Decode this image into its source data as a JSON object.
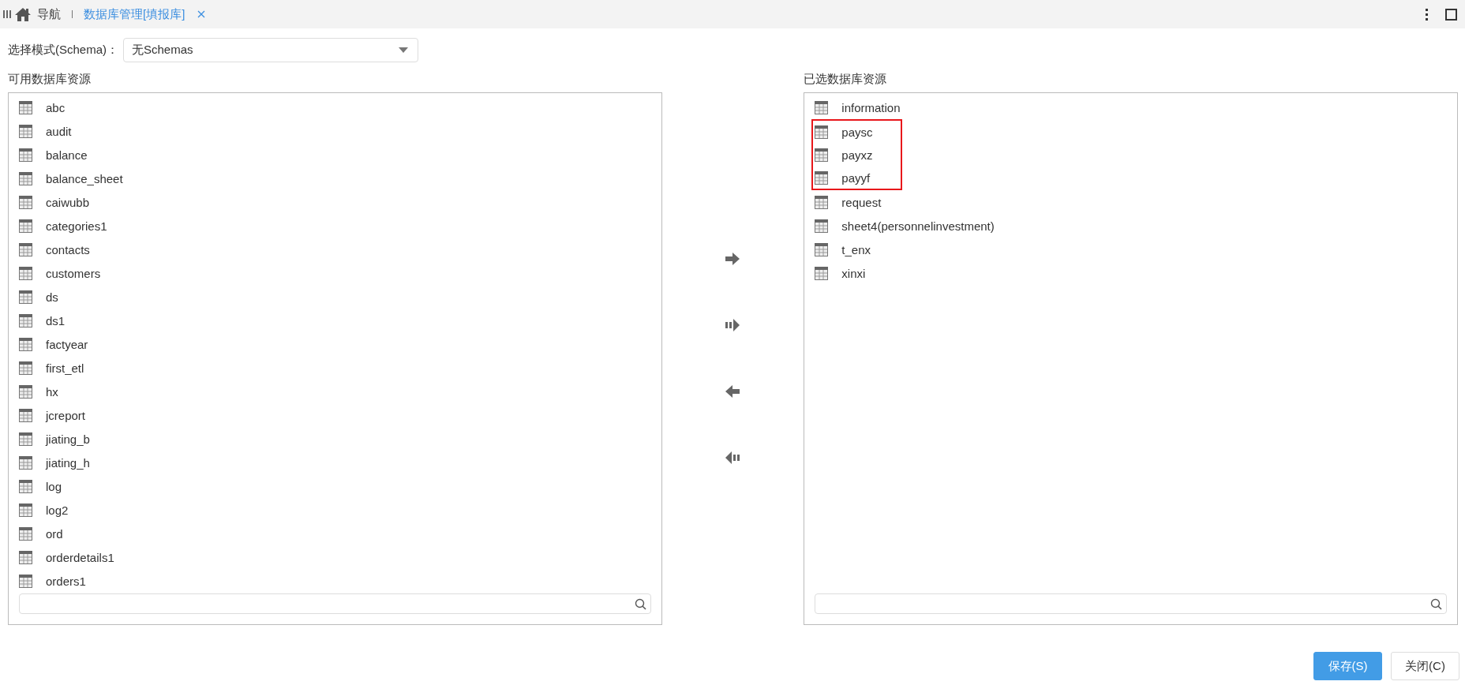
{
  "tabbar": {
    "nav_label": "导航",
    "tabs": [
      {
        "label": "数据库管理[填报库]",
        "selected": true
      }
    ]
  },
  "schema": {
    "label": "选择模式(Schema)：",
    "value": "无Schemas"
  },
  "available": {
    "title": "可用数据库资源",
    "items": [
      {
        "name": "abc"
      },
      {
        "name": "audit"
      },
      {
        "name": "balance"
      },
      {
        "name": "balance_sheet"
      },
      {
        "name": "caiwubb"
      },
      {
        "name": "categories1"
      },
      {
        "name": "contacts"
      },
      {
        "name": "customers"
      },
      {
        "name": "ds"
      },
      {
        "name": "ds1"
      },
      {
        "name": "factyear"
      },
      {
        "name": "first_etl"
      },
      {
        "name": "hx"
      },
      {
        "name": "jcreport"
      },
      {
        "name": "jiating_b"
      },
      {
        "name": "jiating_h"
      },
      {
        "name": "log"
      },
      {
        "name": "log2"
      },
      {
        "name": "ord"
      },
      {
        "name": "orderdetails1"
      },
      {
        "name": "orders1"
      }
    ]
  },
  "transfer_buttons": [
    {
      "kind": "add"
    },
    {
      "kind": "add_all"
    },
    {
      "kind": "remove"
    },
    {
      "kind": "remove_all"
    }
  ],
  "selected_resources": {
    "title": "已选数据库资源",
    "items": [
      {
        "name": "information",
        "highlighted": false
      },
      {
        "name": "paysc",
        "highlighted": true
      },
      {
        "name": "payxz",
        "highlighted": true
      },
      {
        "name": "payyf",
        "highlighted": true
      },
      {
        "name": "request",
        "highlighted": false
      },
      {
        "name": "sheet4(personnelinvestment)",
        "highlighted": false
      },
      {
        "name": "t_enx",
        "highlighted": false
      },
      {
        "name": "xinxi",
        "highlighted": false
      }
    ]
  },
  "buttons": [
    {
      "label": "保存(S)",
      "kind": "primary"
    },
    {
      "label": "关闭(C)",
      "kind": "default"
    }
  ]
}
